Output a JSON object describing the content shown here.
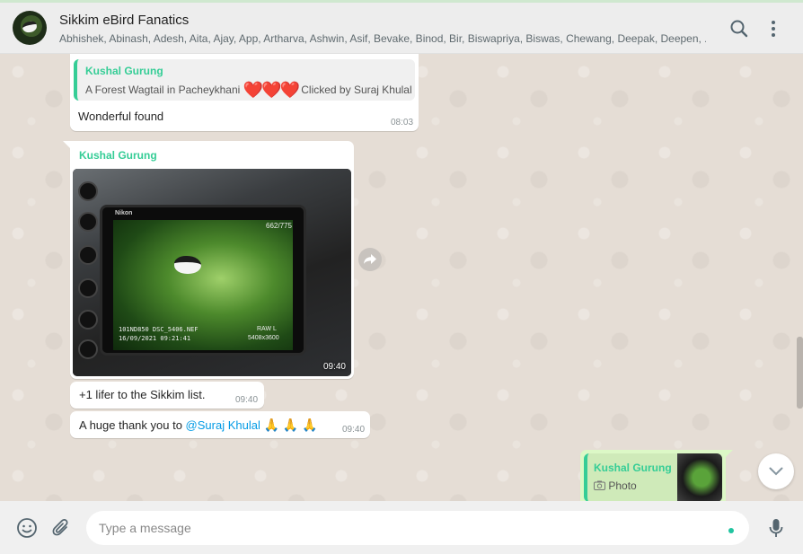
{
  "header": {
    "title": "Sikkim eBird Fanatics",
    "members": "Abhishek, Abinash, Adesh, Aita, Ajay, App, Artharva, Ashwin, Asif, Bevake, Binod, Bir, Biswapriya, Biswas, Chewang, Deepak, Deepen, ...",
    "icons": [
      "search-icon",
      "menu-icon"
    ]
  },
  "messages": {
    "m1": {
      "quote_author": "Kushal Gurung",
      "quote_text_before": "A Forest Wagtail in Pacheykhani",
      "quote_hearts": "❤️❤️❤️",
      "quote_text_after": "Clicked by Suraj Khulal",
      "text": "Wonderful found",
      "time": "08:03"
    },
    "m2": {
      "author": "Kushal Gurung",
      "photo_time": "09:40",
      "screen": {
        "brand": "Nikon",
        "counter": "662/775",
        "info1": "101ND850 DSC_5406.NEF",
        "info2": "16/09/2021  09:21:41",
        "raw": "RAW L",
        "resolution": "5408x3600"
      }
    },
    "m3": {
      "text": "+1 lifer to the Sikkim list.",
      "time": "09:40"
    },
    "m4": {
      "text_before": "A huge thank you to ",
      "mention": "@Suraj Khulal",
      "emoji": "🙏 🙏 🙏",
      "time": "09:40"
    },
    "m5": {
      "quote_author": "Kushal Gurung",
      "quote_type": "Photo"
    }
  },
  "composer": {
    "placeholder": "Type a message",
    "icons": [
      "emoji-icon",
      "attach-icon",
      "mic-icon"
    ]
  },
  "colors": {
    "accent_green": "#35cd96",
    "outgoing_bubble": "#dcf8c6",
    "chat_background": "#e5ddd5",
    "mention_blue": "#039be5"
  }
}
